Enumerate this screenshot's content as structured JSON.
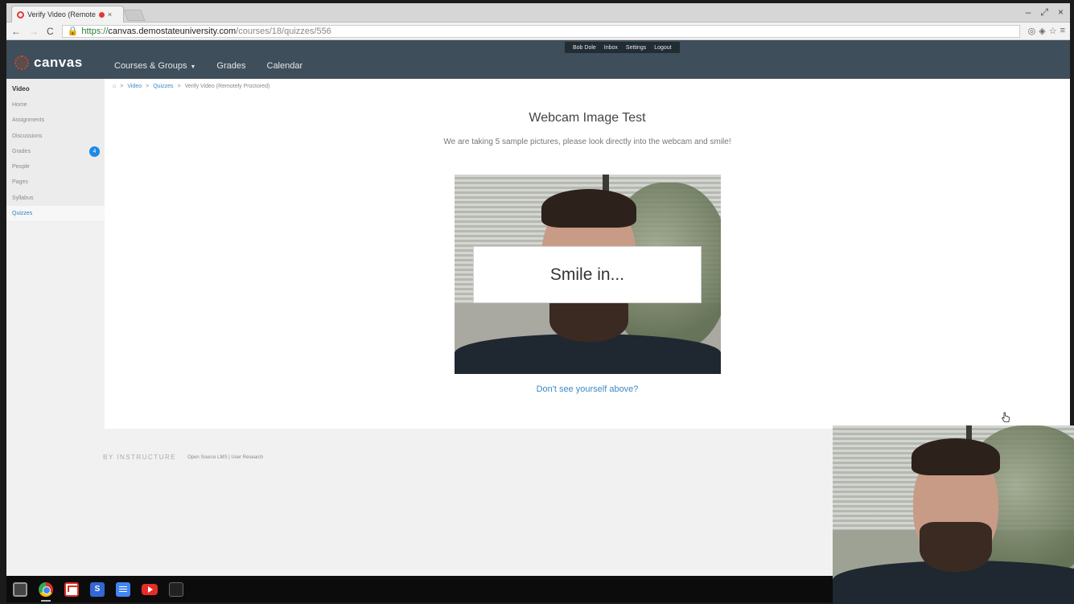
{
  "browser": {
    "tab_title": "Verify Video (Remote",
    "url_scheme": "https://",
    "url_host": "canvas.demostateuniversity.com",
    "url_path": "/courses/18/quizzes/556"
  },
  "header": {
    "logo_text": "canvas",
    "user_links": [
      "Bob Dole",
      "Inbox",
      "Settings",
      "Logout"
    ],
    "nav": [
      "Courses & Groups",
      "Grades",
      "Calendar"
    ]
  },
  "course_nav": {
    "course_name": "Video",
    "items": [
      {
        "label": "Home"
      },
      {
        "label": "Assignments"
      },
      {
        "label": "Discussions"
      },
      {
        "label": "Grades",
        "badge": "4"
      },
      {
        "label": "People"
      },
      {
        "label": "Pages"
      },
      {
        "label": "Syllabus"
      },
      {
        "label": "Quizzes",
        "active": true
      }
    ]
  },
  "breadcrumb": {
    "items": [
      "Video",
      "Quizzes",
      "Verify Video (Remotely Proctored)"
    ]
  },
  "main": {
    "title": "Webcam Image Test",
    "subtitle": "We are taking 5 sample pictures, please look directly into the webcam and smile!",
    "overlay_text": "Smile in...",
    "help_link": "Don't see yourself above?"
  },
  "footer": {
    "brand": "BY INSTRUCTURE",
    "links": "Open Source LMS | User Research"
  },
  "taskbar": {
    "icons": [
      "launcher-icon",
      "chrome-icon",
      "gmail-icon",
      "google-sites-icon",
      "docs-icon",
      "youtube-icon",
      "terminal-icon"
    ]
  },
  "colors": {
    "header_bg": "#3e4e5a",
    "link_blue": "#3b8ac7",
    "badge_blue": "#1e88e5"
  }
}
